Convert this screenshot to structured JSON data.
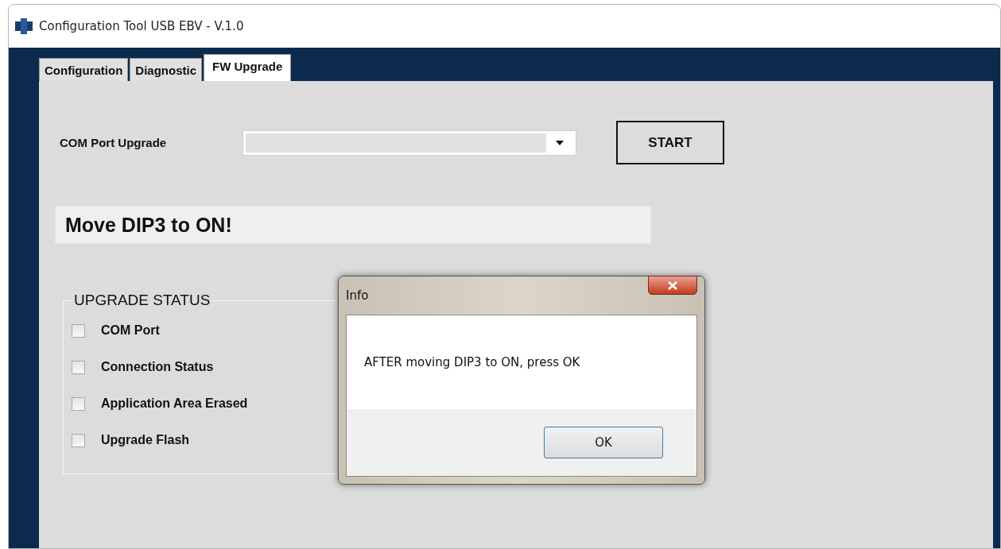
{
  "window": {
    "title": "Configuration Tool USB EBV - V.1.0"
  },
  "tabs": [
    {
      "label": "Configuration",
      "selected": false
    },
    {
      "label": "Diagnostic",
      "selected": false
    },
    {
      "label": "FW Upgrade",
      "selected": true
    }
  ],
  "com_port": {
    "label": "COM Port Upgrade"
  },
  "start_button": "START",
  "message": "Move DIP3 to ON!",
  "upgrade_status": {
    "title": "UPGRADE STATUS",
    "items": [
      {
        "label": "COM Port",
        "checked": false
      },
      {
        "label": "Connection Status",
        "checked": false
      },
      {
        "label": "Application Area Erased",
        "checked": false
      },
      {
        "label": "Upgrade Flash",
        "checked": false
      }
    ]
  },
  "dialog": {
    "title": "Info",
    "text": "AFTER moving DIP3 to ON, press OK",
    "button": "OK"
  }
}
